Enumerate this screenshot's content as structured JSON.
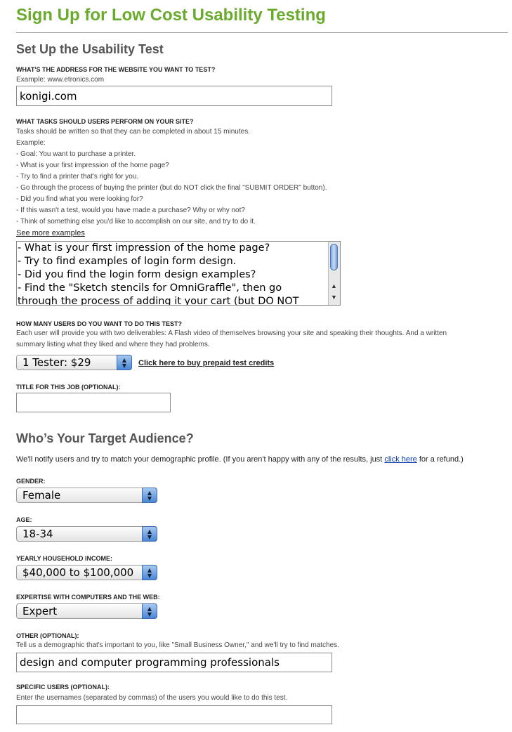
{
  "page_title": "Sign Up for Low Cost Usability Testing",
  "setup": {
    "heading": "Set Up the Usability Test",
    "website_label": "WHAT'S THE ADDRESS FOR THE WEBSITE YOU WANT TO TEST?",
    "website_example": "Example: www.etronics.com",
    "website_value": "konigi.com",
    "tasks_label": "WHAT TASKS SHOULD USERS PERFORM ON YOUR SITE?",
    "tasks_help": [
      "Tasks should be written so that they can be completed in about 15 minutes.",
      "Example:",
      "- Goal: You want to purchase a printer.",
      "- What is your first impression of the home page?",
      "- Try to find a printer that's right for you.",
      "- Go through the process of buying the printer (but do NOT click the final \"SUBMIT ORDER\" button).",
      "- Did you find what you were looking for?",
      "- If this wasn't a test, would you have made a purchase? Why or why not?",
      "- Think of something else you'd like to accomplish on our site, and try to do it."
    ],
    "see_more_link": "See more examples",
    "tasks_value_lines": [
      "- What is your first impression of the home page?",
      "- Try to find examples of login form design.",
      "- Did you find the login form design examples?",
      "- Find the \"Sketch stencils for OmniGraffle\", then go",
      "through the process of adding it your cart (but DO NOT"
    ],
    "users_label": "HOW MANY USERS DO YOU WANT TO DO THIS TEST?",
    "users_help_1": "Each user will provide you with two deliverables: A Flash video of themselves browsing your site and speaking their thoughts. And a written",
    "users_help_2": "summary listing what they liked and where they had problems.",
    "testers_selected": "1 Tester: $29",
    "prepaid_link": "Click here to buy prepaid test credits",
    "title_label": "TITLE FOR THIS JOB (OPTIONAL):",
    "title_value": ""
  },
  "audience": {
    "heading": "Who’s Your Target Audience?",
    "intro_before": "We'll notify users and try to match your demographic profile. (If you aren't happy with any of the results, just ",
    "intro_link": "click here",
    "intro_after": " for a refund.)",
    "gender_label": "GENDER:",
    "gender_value": "Female",
    "age_label": "AGE:",
    "age_value": "18-34",
    "income_label": "YEARLY HOUSEHOLD INCOME:",
    "income_value": "$40,000 to $100,000",
    "expertise_label": "EXPERTISE WITH COMPUTERS AND THE WEB:",
    "expertise_value": "Expert",
    "other_label": "OTHER (OPTIONAL):",
    "other_help": "Tell us a demographic that's important to you, like \"Small Business Owner,\" and we'll try to find matches.",
    "other_value": "design and computer programming professionals",
    "specific_label": "SPECIFIC USERS (OPTIONAL):",
    "specific_help": "Enter the usernames (separated by commas) of the users you would like to do this test.",
    "specific_value": ""
  }
}
